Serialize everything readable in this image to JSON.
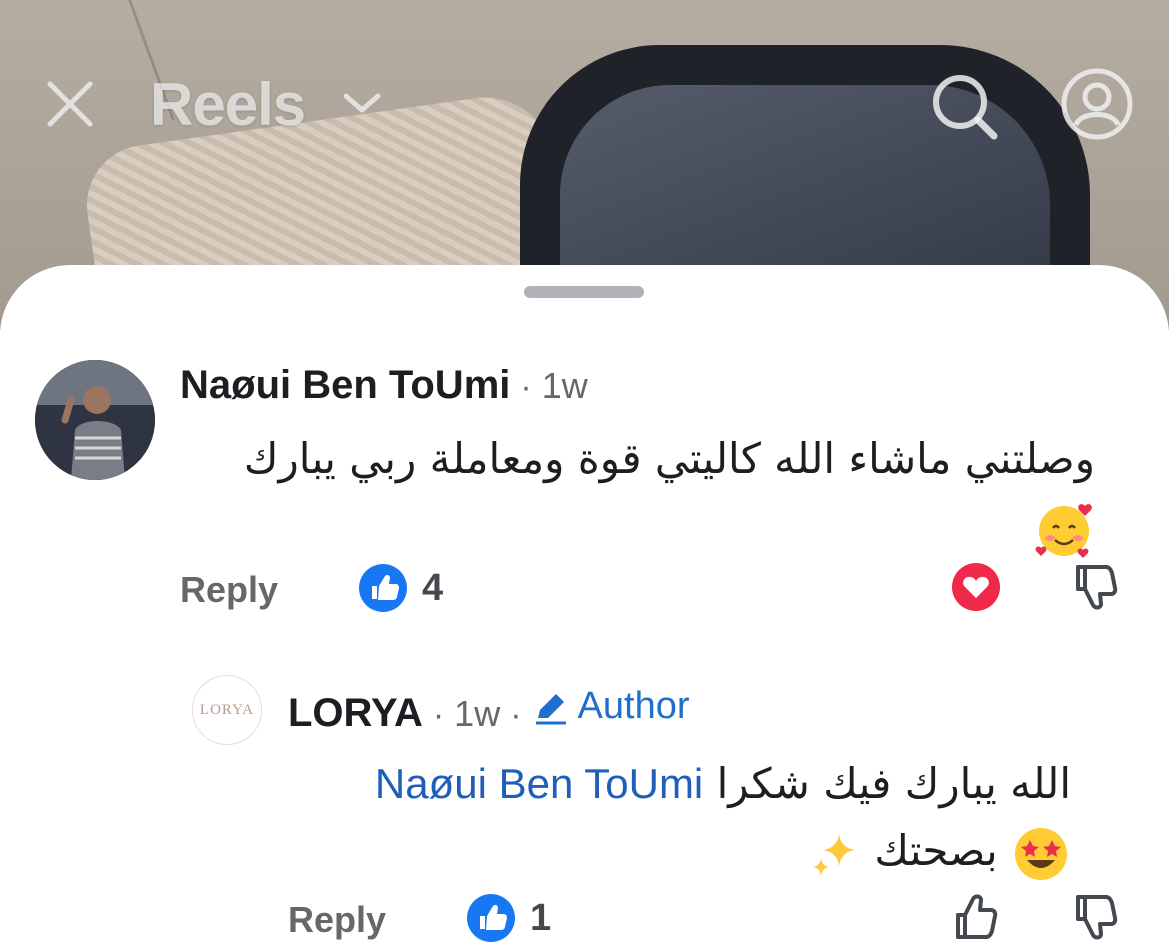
{
  "topbar": {
    "title": "Reels"
  },
  "comments": [
    {
      "author": "Naøui Ben ToUmi",
      "time": "1w",
      "text": "وصلتني ماشاء الله كاليتي قوة ومعاملة ربي يبارك",
      "emoji": "smiling-face-with-hearts-emoji",
      "reply_label": "Reply",
      "like_count": "4",
      "reacted": "heart"
    },
    {
      "author": "LORYA",
      "avatar_text": "LORYA",
      "time": "1w",
      "badge_label": "Author",
      "mention": "Naøui Ben ToUmi",
      "text_line1": "الله يبارك فيك شكرا",
      "text_line2": "بصحتك",
      "reply_label": "Reply",
      "like_count": "1"
    }
  ],
  "colors": {
    "accent_blue": "#1877f2",
    "mention_blue": "#1f5fb8",
    "heart_red": "#f02849",
    "secondary_text": "#65676b"
  }
}
